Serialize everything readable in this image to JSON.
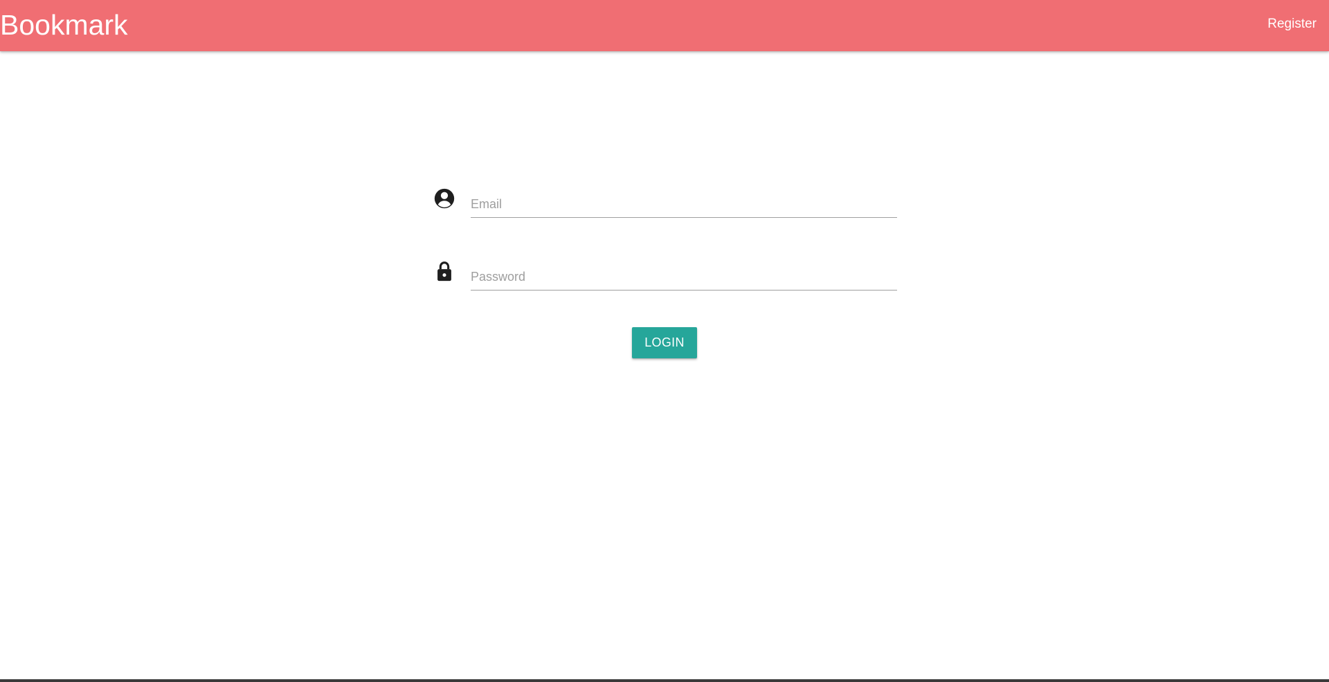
{
  "navbar": {
    "brand": "Bookmark",
    "register_link": "Register",
    "background_color": "#f06e73"
  },
  "login_form": {
    "email": {
      "icon": "account-circle-icon",
      "placeholder": "Email",
      "value": ""
    },
    "password": {
      "icon": "lock-icon",
      "placeholder": "Password",
      "value": ""
    },
    "submit_label": "LOGIN",
    "submit_color": "#26a69a"
  }
}
